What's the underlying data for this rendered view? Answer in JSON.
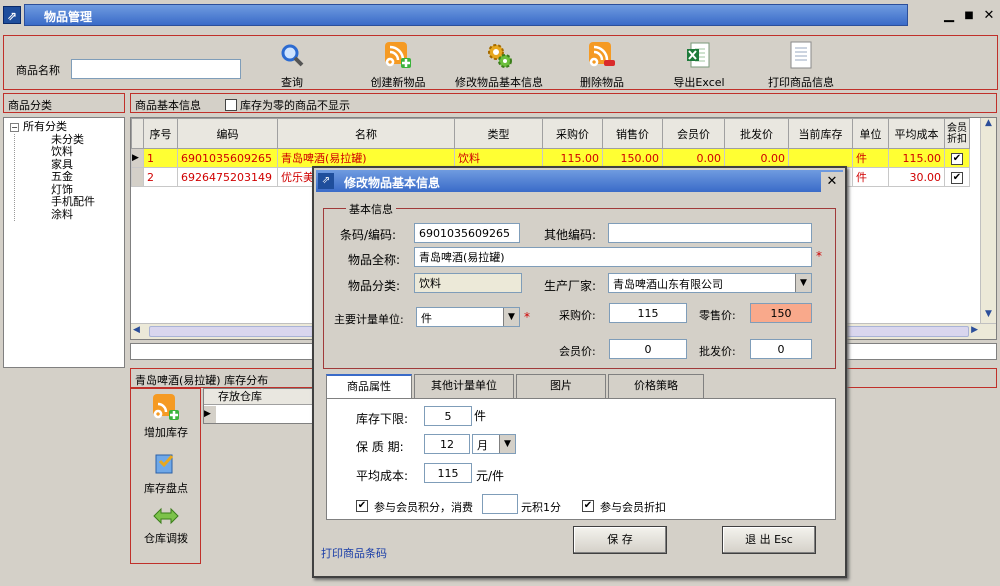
{
  "window": {
    "title": "物品管理",
    "min": "▁",
    "max": "■",
    "close": "✕"
  },
  "toolbar": {
    "search_label": "商品名称",
    "search_value": "",
    "buttons": [
      {
        "label": "查询",
        "icon": "magnifier-icon"
      },
      {
        "label": "创建新物品",
        "icon": "rss-add-icon"
      },
      {
        "label": "修改物品基本信息",
        "icon": "gears-icon"
      },
      {
        "label": "删除物品",
        "icon": "rss-remove-icon"
      },
      {
        "label": "导出Excel",
        "icon": "excel-icon"
      },
      {
        "label": "打印商品信息",
        "icon": "document-icon"
      }
    ]
  },
  "category_panel": {
    "title": "商品分类"
  },
  "tree": {
    "root": "所有分类",
    "items": [
      "未分类",
      "饮料",
      "家具",
      "五金",
      "灯饰",
      "手机配件",
      "涂料"
    ]
  },
  "info_header": {
    "title": "商品基本信息",
    "filter_label": "库存为零的商品不显示"
  },
  "grid": {
    "columns": [
      "序号",
      "编码",
      "名称",
      "类型",
      "采购价",
      "销售价",
      "会员价",
      "批发价",
      "当前库存",
      "单位",
      "平均成本",
      "会员折扣"
    ],
    "rows": [
      {
        "no": "1",
        "code": "6901035609265",
        "name": "青岛啤酒(易拉罐)",
        "type": "饮料",
        "purchase": "115.00",
        "sale": "150.00",
        "member": "0.00",
        "wholesale": "0.00",
        "stock": "",
        "unit": "件",
        "cost": "115.00",
        "discount": "✔"
      },
      {
        "no": "2",
        "code": "6926475203149",
        "name": "优乐美",
        "type": "",
        "purchase": "",
        "sale": "",
        "member": "",
        "wholesale": "",
        "stock": "",
        "unit": "件",
        "cost": "30.00",
        "discount": "✔"
      }
    ]
  },
  "stock_panel": {
    "title": "青岛啤酒(易拉罐) 库存分布",
    "column": "存放仓库",
    "buttons": [
      {
        "label": "增加库存",
        "icon": "add-stock-icon"
      },
      {
        "label": "库存盘点",
        "icon": "inventory-check-icon"
      },
      {
        "label": "仓库调拨",
        "icon": "transfer-icon"
      }
    ]
  },
  "dialog": {
    "title": "修改物品基本信息",
    "close": "✕",
    "group_title": "基本信息",
    "barcode_label": "条码/编码:",
    "barcode_value": "6901035609265",
    "other_code_label": "其他编码:",
    "other_code_value": "",
    "fullname_label": "物品全称:",
    "fullname_value": "青岛啤酒(易拉罐)",
    "category_label": "物品分类:",
    "category_value": "饮料",
    "maker_label": "生产厂家:",
    "maker_value": "青岛啤酒山东有限公司",
    "unit_label": "主要计量单位:",
    "unit_value": "件",
    "purchase_label": "采购价:",
    "purchase_value": "115",
    "retail_label": "零售价:",
    "retail_value": "150",
    "member_label": "会员价:",
    "member_value": "0",
    "wholesale_label": "批发价:",
    "wholesale_value": "0",
    "req": "*",
    "tabs": [
      "商品属性",
      "其他计量单位",
      "图片",
      "价格策略"
    ],
    "min_stock_label": "库存下限:",
    "min_stock_value": "5",
    "min_stock_unit": "件",
    "shelf_label": "保 质 期:",
    "shelf_value": "12",
    "shelf_unit": "月",
    "avg_cost_label": "平均成本:",
    "avg_cost_value": "115",
    "avg_cost_unit": "元/件",
    "points_label": "参与会员积分，消费",
    "points_value": "",
    "points_suffix": "元积1分",
    "member_discount_label": "参与会员折扣",
    "print_barcode": "打印商品条码",
    "save": "保 存",
    "exit": "退 出 Esc"
  },
  "colors": {
    "accent": "#3a6bc8",
    "selected_row": "#ffff33",
    "retail_highlight": "#f9a98b",
    "border_red": "#c0302a"
  }
}
